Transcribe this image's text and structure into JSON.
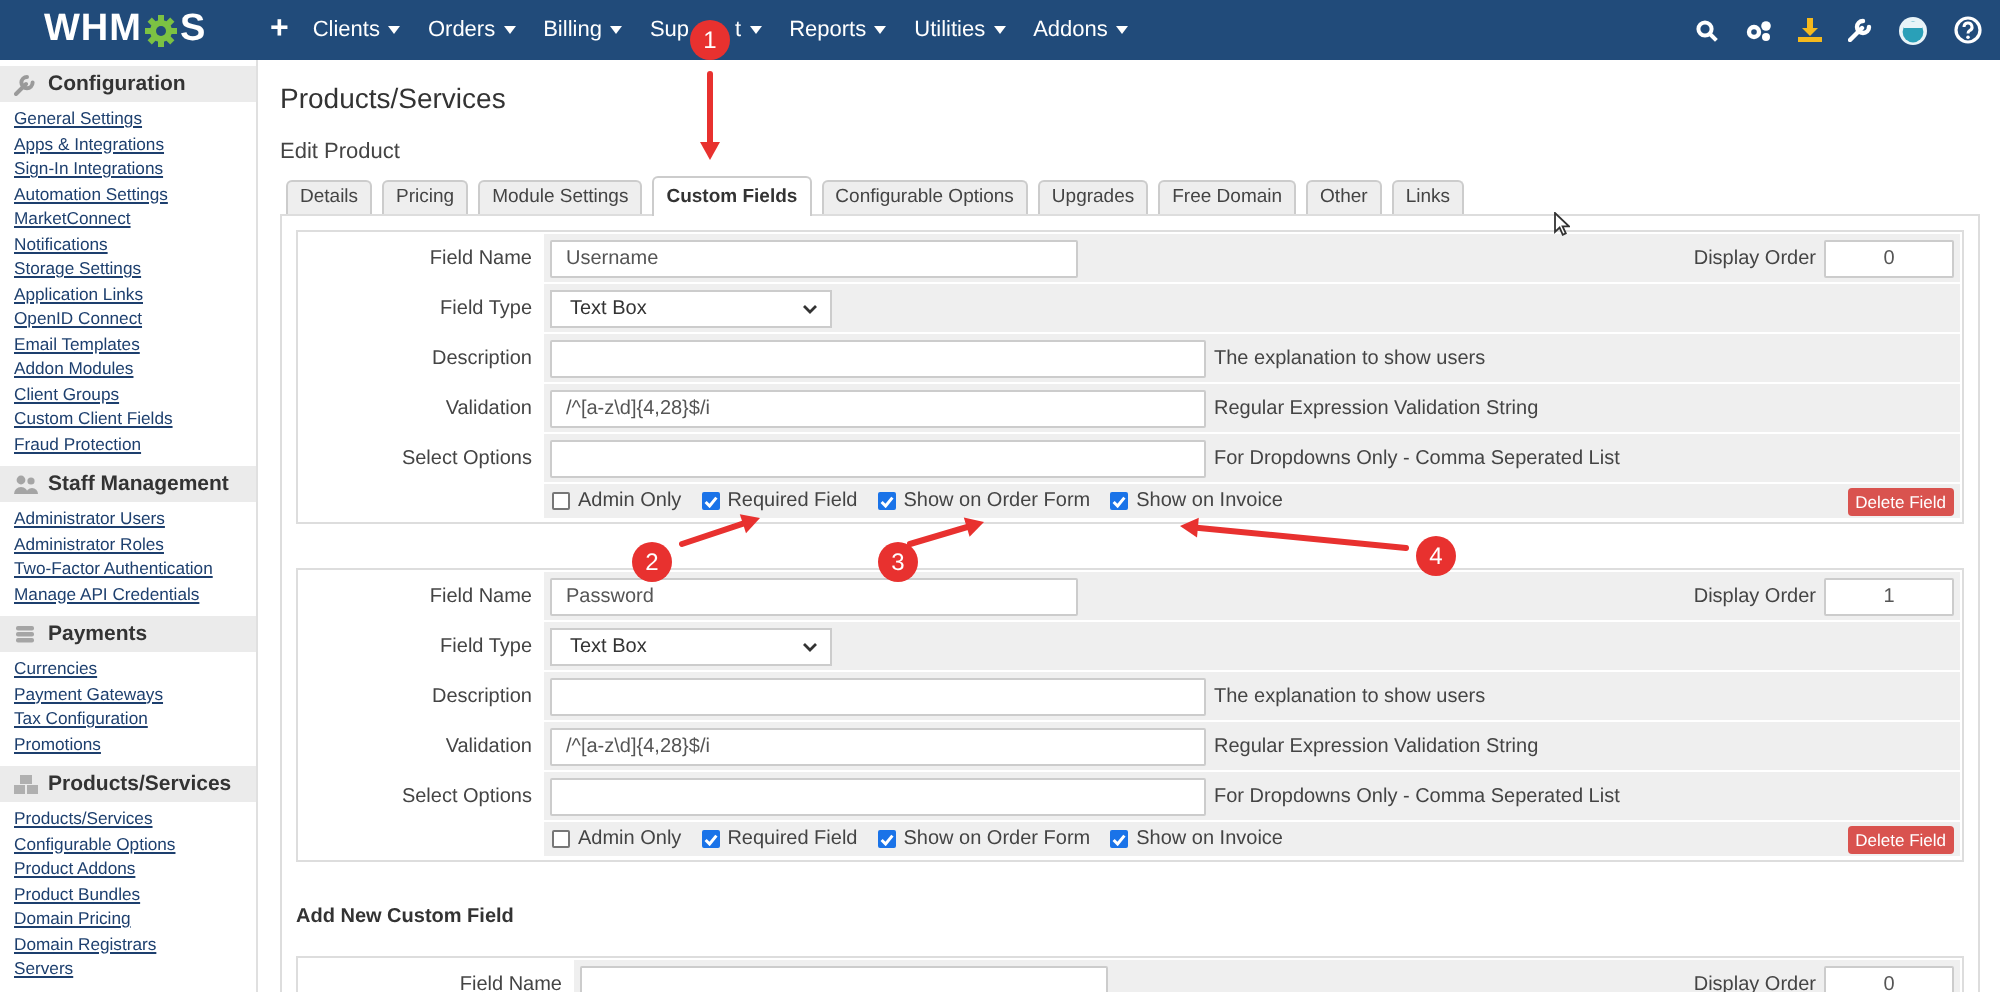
{
  "navbar": {
    "logo": [
      "WHM",
      "S"
    ],
    "menu": [
      {
        "kind": "add",
        "label": "+"
      },
      {
        "kind": "dropdown",
        "label": "Clients"
      },
      {
        "kind": "dropdown",
        "label": "Orders"
      },
      {
        "kind": "dropdown",
        "label": "Billing"
      },
      {
        "kind": "dropdown",
        "label": "Sup",
        "label_after": "t"
      },
      {
        "kind": "dropdown",
        "label": "Reports"
      },
      {
        "kind": "dropdown",
        "label": "Utilities"
      },
      {
        "kind": "dropdown",
        "label": "Addons"
      }
    ]
  },
  "sidebar": [
    {
      "title": "Configuration",
      "links": [
        "General Settings",
        "Apps & Integrations",
        "Sign-In Integrations",
        "Automation Settings",
        "MarketConnect",
        "Notifications",
        "Storage Settings",
        "Application Links",
        "OpenID Connect",
        "Email Templates",
        "Addon Modules",
        "Client Groups",
        "Custom Client Fields",
        "Fraud Protection"
      ]
    },
    {
      "title": "Staff Management",
      "links": [
        "Administrator Users",
        "Administrator Roles",
        "Two-Factor Authentication",
        "Manage API Credentials"
      ]
    },
    {
      "title": "Payments",
      "links": [
        "Currencies",
        "Payment Gateways",
        "Tax Configuration",
        "Promotions"
      ]
    },
    {
      "title": "Products/Services",
      "links": [
        "Products/Services",
        "Configurable Options",
        "Product Addons",
        "Product Bundles",
        "Domain Pricing",
        "Domain Registrars",
        "Servers"
      ]
    }
  ],
  "page": {
    "title": "Products/Services",
    "subtitle": "Edit Product"
  },
  "tabs": [
    {
      "label": "Details",
      "selected": false
    },
    {
      "label": "Pricing",
      "selected": false
    },
    {
      "label": "Module Settings",
      "selected": false
    },
    {
      "label": "Custom Fields",
      "selected": true
    },
    {
      "label": "Configurable Options",
      "selected": false
    },
    {
      "label": "Upgrades",
      "selected": false
    },
    {
      "label": "Free Domain",
      "selected": false
    },
    {
      "label": "Other",
      "selected": false
    },
    {
      "label": "Links",
      "selected": false
    }
  ],
  "custom_fields": [
    {
      "field_name_label": "Field Name",
      "field_name": "Username",
      "display_order_label": "Display Order",
      "display_order": "0",
      "field_type_label": "Field Type",
      "field_type": "Text Box",
      "description_label": "Description",
      "description_hint": "The explanation to show users",
      "validation_label": "Validation",
      "validation": "/^[a-z\\d]{4,28}$/i",
      "validation_hint": "Regular Expression Validation String",
      "select_options_label": "Select Options",
      "select_options_hint": "For Dropdowns Only - Comma Seperated List",
      "options": [
        {
          "label": "Admin Only",
          "checked": false
        },
        {
          "label": "Required Field",
          "checked": true
        },
        {
          "label": "Show on Order Form",
          "checked": true
        },
        {
          "label": "Show on Invoice",
          "checked": true
        }
      ],
      "delete_button": "Delete Field"
    },
    {
      "field_name_label": "Field Name",
      "field_name": "Password",
      "display_order_label": "Display Order",
      "display_order": "1",
      "field_type_label": "Field Type",
      "field_type": "Text Box",
      "description_label": "Description",
      "description_hint": "The explanation to show users",
      "validation_label": "Validation",
      "validation": "/^[a-z\\d]{4,28}$/i",
      "validation_hint": "Regular Expression Validation String",
      "select_options_label": "Select Options",
      "select_options_hint": "For Dropdowns Only - Comma Seperated List",
      "options": [
        {
          "label": "Admin Only",
          "checked": false
        },
        {
          "label": "Required Field",
          "checked": true
        },
        {
          "label": "Show on Order Form",
          "checked": true
        },
        {
          "label": "Show on Invoice",
          "checked": true
        }
      ],
      "delete_button": "Delete Field"
    }
  ],
  "add_new": {
    "heading": "Add New Custom Field",
    "field_name_label": "Field Name",
    "display_order_label": "Display Order",
    "display_order": "0"
  },
  "annotations": [
    {
      "label": "1"
    },
    {
      "label": "2"
    },
    {
      "label": "3"
    },
    {
      "label": "4"
    }
  ]
}
